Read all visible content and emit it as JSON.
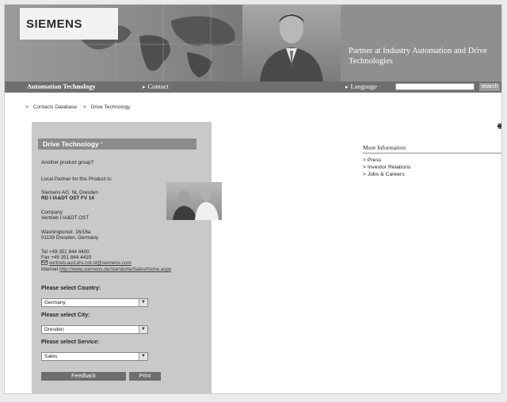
{
  "header": {
    "logo": "SIEMENS",
    "tagline": "Partner at Industry Automation and Drive Technologies"
  },
  "nav": {
    "automation": "Automation Technology",
    "contact": "Contact",
    "language": "Language",
    "search_value": "",
    "search_button": "search"
  },
  "breadcrumb": {
    "items": [
      "Contacts Database",
      "Drive Technology"
    ]
  },
  "panel": {
    "title": "Drive Technology",
    "title_marker": "*",
    "another_group": "Another product group?",
    "local_partner": "Local Partner for this Product is:",
    "company_name": "Siemens AG, NL Dresden",
    "dept": "RD I IA&DT OST FV 14",
    "company_label": "Company",
    "company_value": "Vertrieb I IA&DT OST",
    "street": "Washingtonstr. 16/16a",
    "city_line": "01139 Dresden, Germany",
    "tel": "Tel +49 351 844 4400",
    "fax": "Fax +49 351 844 4410",
    "email": "vertrieb.aud.drs.ost.nl@siemens.com",
    "internet_label": "Internet",
    "internet_url": "http://www.siemens.de/standorte/Sales/home.aspx",
    "country_label": "Please select Country:",
    "country_value": "Germany",
    "city_label": "Please select City:",
    "city_value": "Dresden",
    "service_label": "Please select Service:",
    "service_value": "Sales",
    "feedback_button": "Feedback",
    "print_button": "Print"
  },
  "more": {
    "title": "More Information",
    "items": [
      "Press",
      "Investor Relations",
      "Jobs & Careers"
    ]
  },
  "icons": {
    "arrow": "▸",
    "breadcrumb_arrow": ">",
    "dropdown": "▼"
  },
  "colors": {
    "header_gray": "#8c8c8c",
    "nav_gray": "#6f6f6f",
    "panel_gray": "#c9c9c9"
  }
}
